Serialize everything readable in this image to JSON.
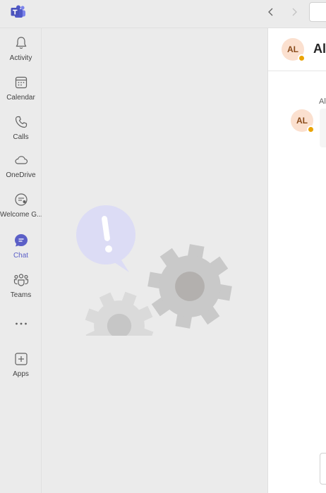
{
  "app": {
    "name": "Microsoft Teams",
    "logo_icon": "teams-logo-icon",
    "brand_color": "#5b5fc7"
  },
  "topbar": {
    "back_icon": "chevron-left-icon",
    "forward_icon": "chevron-right-icon"
  },
  "rail": {
    "items": [
      {
        "label": "Activity",
        "icon": "bell-icon"
      },
      {
        "label": "Calendar",
        "icon": "calendar-icon"
      },
      {
        "label": "Calls",
        "icon": "phone-icon"
      },
      {
        "label": "OneDrive",
        "icon": "cloud-icon"
      },
      {
        "label": "Welcome G...",
        "icon": "welcome-app-icon"
      },
      {
        "label": "Chat",
        "icon": "chat-icon",
        "active": true
      },
      {
        "label": "Teams",
        "icon": "teams-people-icon"
      },
      {
        "label": "",
        "icon": "more-horizontal-icon"
      },
      {
        "label": "Apps",
        "icon": "add-apps-icon"
      }
    ]
  },
  "chat": {
    "header": {
      "avatar_initials": "AL",
      "title": "Al",
      "presence_color": "#eaa300"
    },
    "message": {
      "sender": "Al",
      "avatar_initials": "AL"
    }
  }
}
